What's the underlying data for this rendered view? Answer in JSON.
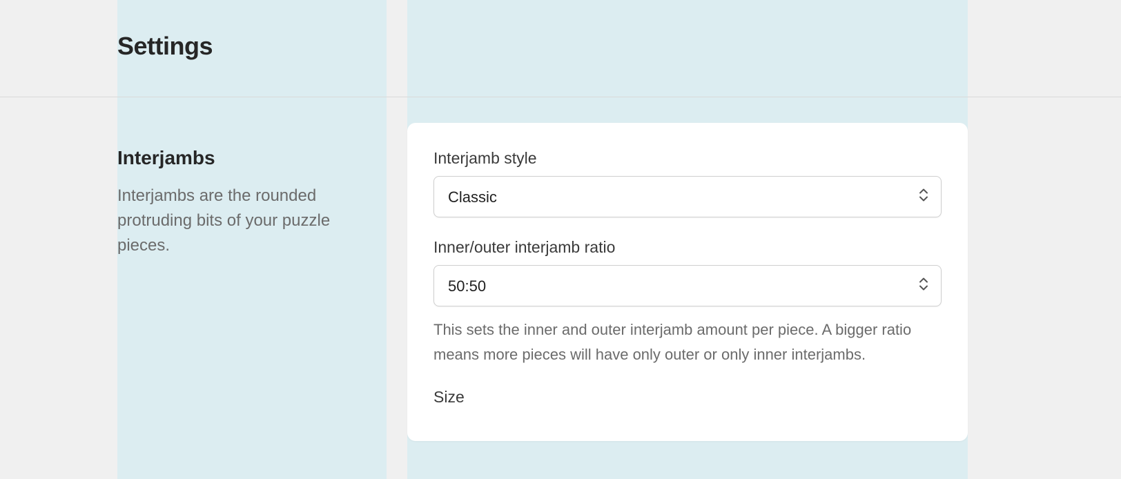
{
  "page": {
    "title": "Settings"
  },
  "sidebar": {
    "section_title": "Interjambs",
    "section_description": "Interjambs are the rounded protruding bits of your puzzle pieces."
  },
  "form": {
    "style": {
      "label": "Interjamb style",
      "value": "Classic"
    },
    "ratio": {
      "label": "Inner/outer interjamb ratio",
      "value": "50:50",
      "help": "This sets the inner and outer interjamb amount per piece. A bigger ratio means more pieces will have only outer or only inner interjambs."
    },
    "size": {
      "label": "Size"
    }
  }
}
